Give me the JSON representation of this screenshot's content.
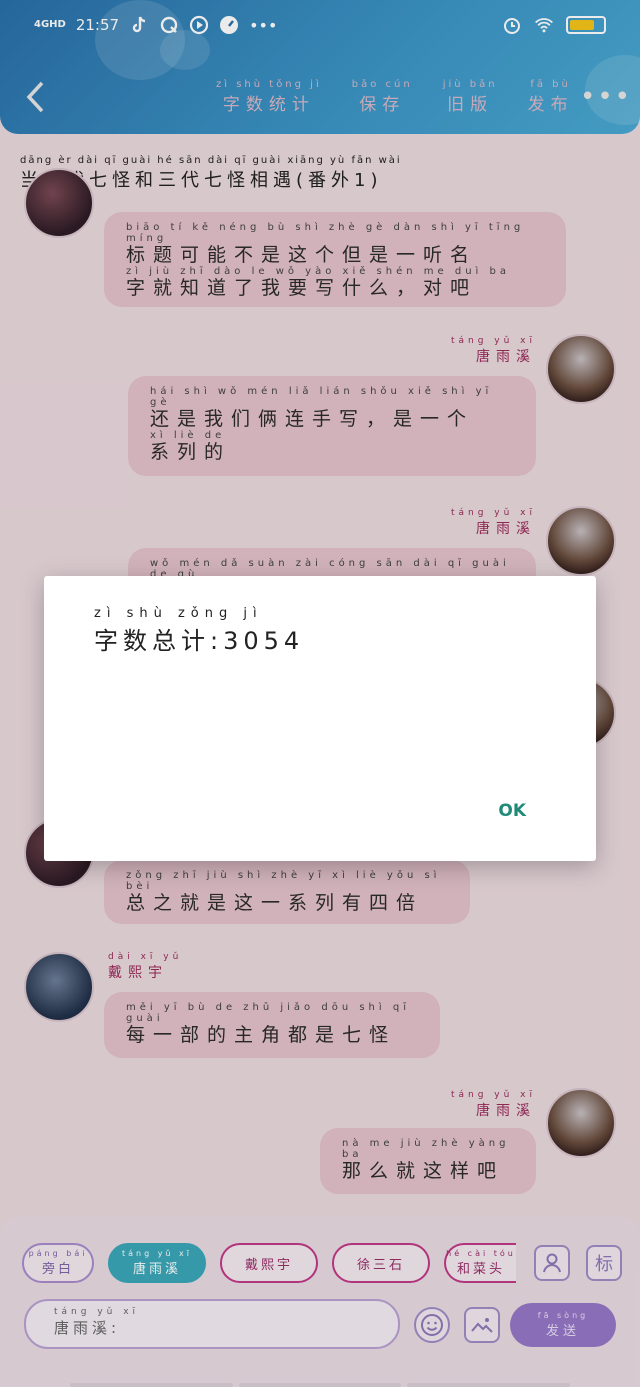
{
  "status": {
    "network": "4GHD",
    "time": "21:57",
    "colors": {
      "battery": "#f5c518"
    }
  },
  "header": {
    "back_icon": "chevron-left-icon",
    "actions": [
      {
        "py": "zì shù tǒng jì",
        "hz": "字数统计"
      },
      {
        "py": "bǎo cún",
        "hz": "保存"
      },
      {
        "py": "jiù bǎn",
        "hz": "旧版"
      },
      {
        "py": "fā bù",
        "hz": "发布"
      }
    ],
    "more_icon": "more-dots-icon"
  },
  "story": {
    "title_py": "dāng èr dài qī guài hé sān dài qī guài xiāng yù fān wài",
    "title_hz": "当二代七怪和三代七怪相遇(番外1)"
  },
  "messages": [
    {
      "py1": "biāo tí kě néng bù shì zhè gè dàn shì yī tīng míng",
      "hz1": "标题可能不是这个但是一听名",
      "py2": "zì jiù zhī dào le wǒ yào xiě shén me duì ba",
      "hz2": "字就知道了我要写什么，对吧"
    },
    {
      "name_py": "táng yǔ xī",
      "name_hz": "唐雨溪",
      "py1": "hái shì wǒ mén liǎ lián shǒu xiě shì yī gè",
      "hz1": "还是我们俩连手写，是一个",
      "py2": "xì liè de",
      "hz2": "系列的"
    },
    {
      "name_py": "táng yǔ xī",
      "name_hz": "唐雨溪",
      "py1": "wǒ mén dǎ suàn zài cóng sān dài qī guài de gù",
      "hz1": ""
    },
    {
      "py1": "zǒng zhī jiù shì zhè yī xì liè yǒu sì bèi",
      "hz1": "总之就是这一系列有四倍"
    },
    {
      "name_py": "dài xī yǔ",
      "name_hz": "戴熙宇",
      "py1": "měi yī bù de zhǔ jiǎo dōu shì qī guài",
      "hz1": "每一部的主角都是七怪"
    },
    {
      "name_py": "táng yǔ xī",
      "name_hz": "唐雨溪",
      "py1": "nà me jiù zhè yàng ba",
      "hz1": "那么就这样吧"
    }
  ],
  "dialog": {
    "label_py": "zì shù zǒng jì",
    "label_hz": "字数总计",
    "value": ":3054",
    "ok": "OK",
    "colors": {
      "ok": "#1f8a78"
    }
  },
  "composer": {
    "chips": [
      {
        "py": "páng bái",
        "hz": "旁白"
      },
      {
        "py": "táng yǔ xī",
        "hz": "唐雨溪"
      },
      {
        "py": "",
        "hz": "戴熙宇"
      },
      {
        "py": "",
        "hz": "徐三石"
      },
      {
        "py": "hé cài tóu",
        "hz": "和菜头"
      }
    ],
    "person_icon": "person-icon",
    "tag_label": "标",
    "input_py": "táng yǔ xī",
    "input_hz": "唐雨溪:",
    "emoji_icon": "emoji-icon",
    "image_icon": "image-icon",
    "send_py": "fā sòng",
    "send_hz": "发送",
    "colors": {
      "active_chip": "#3aa7b9",
      "send": "#9677c7"
    }
  }
}
